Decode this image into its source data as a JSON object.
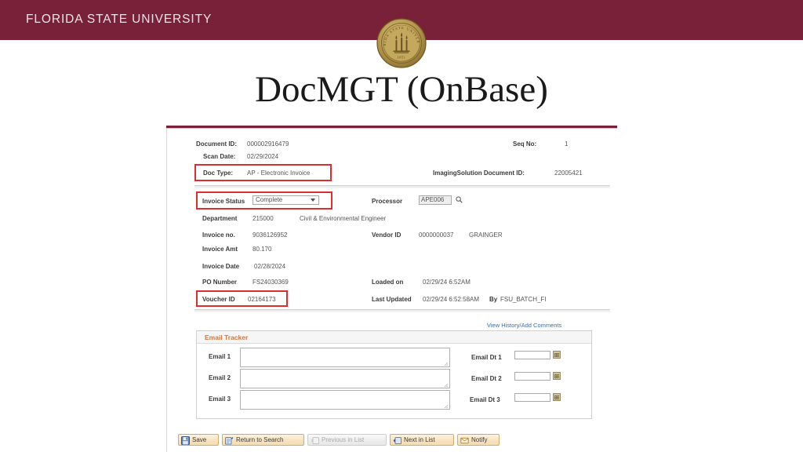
{
  "banner": {
    "institution": "FLORIDA STATE UNIVERSITY",
    "bar_color": "#782139",
    "seal": {
      "icon": "fsu-seal-icon",
      "top_text": "FLORIDA STATE UNIVERSITY",
      "year": "1851"
    }
  },
  "slide": {
    "title": "DocMGT (OnBase)"
  },
  "form": {
    "header_fields": {
      "document_id_label": "Document ID:",
      "document_id_value": "000002916479",
      "seq_no_label": "Seq No:",
      "seq_no_value": "1",
      "scan_date_label": "Scan Date:",
      "scan_date_value": "02/29/2024",
      "doc_type_label": "Doc Type:",
      "doc_type_value": "AP - Electronic Invoice",
      "imaging_solution_label": "ImagingSolution Document ID:",
      "imaging_solution_value": "22005421"
    },
    "invoice_status_label": "Invoice Status",
    "invoice_status_value": "Complete",
    "processor_label": "Processor",
    "processor_value": "APE006",
    "processor_lookup_icon": "magnifier-icon",
    "department_label": "Department",
    "department_value": "215000",
    "department_name": "Civil & Environmental Engineer",
    "invoice_no_label": "Invoice no.",
    "invoice_no_value": "9036126952",
    "vendor_id_label": "Vendor ID",
    "vendor_id_value": "0000000037",
    "vendor_name": "GRAINGER",
    "invoice_amt_label": "Invoice Amt",
    "invoice_amt_value": "80.170",
    "invoice_date_label": "Invoice Date",
    "invoice_date_value": "02/28/2024",
    "po_number_label": "PO Number",
    "po_number_value": "FS24030369",
    "loaded_on_label": "Loaded on",
    "loaded_on_value": "02/29/24  6:52AM",
    "voucher_id_label": "Voucher ID",
    "voucher_id_value": "02164173",
    "last_updated_label": "Last Updated",
    "last_updated_value": "02/29/24  6:52:58AM",
    "last_updated_by_label": "By",
    "last_updated_by_value": "FSU_BATCH_FI"
  },
  "email_tracker": {
    "history_link": "View History/Add Comments",
    "panel_title": "Email Tracker",
    "rows": [
      {
        "email_label": "Email 1",
        "email_value": "",
        "date_label": "Email Dt 1",
        "date_value": "",
        "date_icon": "calendar-icon"
      },
      {
        "email_label": "Email 2",
        "email_value": "",
        "date_label": "Email Dt 2",
        "date_value": "",
        "date_icon": "calendar-icon"
      },
      {
        "email_label": "Email 3",
        "email_value": "",
        "date_label": "Email Dt 3",
        "date_value": "",
        "date_icon": "calendar-icon"
      }
    ]
  },
  "toolbar": {
    "buttons": [
      {
        "label": "Save",
        "icon": "save-disk-icon",
        "disabled": false
      },
      {
        "label": "Return to Search",
        "icon": "return-search-icon",
        "disabled": false
      },
      {
        "label": "Previous in List",
        "icon": "previous-arrow-icon",
        "disabled": true
      },
      {
        "label": "Next in List",
        "icon": "next-arrow-icon",
        "disabled": false
      },
      {
        "label": "Notify",
        "icon": "notify-envelope-icon",
        "disabled": false
      }
    ]
  },
  "annotations": {
    "highlight_color": "#d83030",
    "highlighted_fields": [
      "Doc Type",
      "Invoice Status",
      "Voucher ID"
    ]
  }
}
